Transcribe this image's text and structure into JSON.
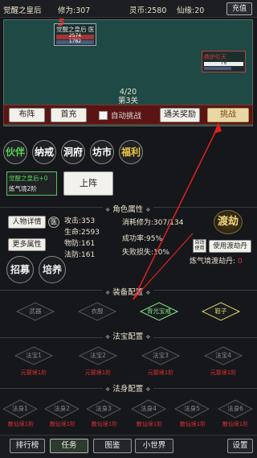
{
  "topbar": {
    "player_name": "觉醒之皇后",
    "cultivation": "修为:307",
    "spirit_stone": "灵币:2580",
    "immortal_jade": "仙缘:20",
    "recharge": "充值"
  },
  "battle": {
    "player_card": {
      "name": "觉醒之皇后 医",
      "hp": "2574",
      "mp": "1782",
      "level_mark": "5"
    },
    "enemy_card": {
      "name": "鼎炉引天",
      "hp": "76"
    },
    "progress": "4/20",
    "stage": "第3关",
    "buttons": {
      "formation": "布阵",
      "first_recharge": "首充",
      "auto_challenge": "自动挑战",
      "clear_reward": "通关奖励",
      "challenge": "挑战"
    }
  },
  "menu": [
    {
      "label": "伙伴",
      "color": "#57d05a"
    },
    {
      "label": "纳戒",
      "color": "#ffffff"
    },
    {
      "label": "洞府",
      "color": "#ffffff"
    },
    {
      "label": "坊市",
      "color": "#ffffff"
    },
    {
      "label": "福利",
      "color": "#e9c445"
    }
  ],
  "companion": {
    "name": "觉醒之皇后+0",
    "realm": "炼气境2阶",
    "deploy": "上阵"
  },
  "attributes": {
    "section_title": "角色属性",
    "person_detail": "人物详情",
    "med_tag": "医",
    "more_attr": "更多属性",
    "recruit": "招募",
    "train": "培养",
    "attack": "攻击:353",
    "hp": "生命:2593",
    "phys_def": "物防:161",
    "magic_def": "法防:161",
    "consume": "消耗修为:307/134",
    "success": "成功率:95%",
    "fail_loss": "失败损失:10%",
    "tribulation": "渡劫",
    "auto_use": "自动使用",
    "use_pill": "使用渡劫丹",
    "pill_label": "炼气境渡劫丹:",
    "pill_count": "0"
  },
  "equipment": {
    "section_title": "装备配置",
    "slots": [
      {
        "label": "武器",
        "state": "empty"
      },
      {
        "label": "衣服",
        "state": "empty"
      },
      {
        "label": "青光宝戒",
        "state": "active"
      },
      {
        "label": "鞋子",
        "state": "yellow"
      }
    ]
  },
  "treasure": {
    "section_title": "法宝配置",
    "slots": [
      {
        "label": "法宝1",
        "req": "元婴境1阶"
      },
      {
        "label": "法宝2",
        "req": "元婴境1阶"
      },
      {
        "label": "法宝3",
        "req": "元婴境1阶"
      },
      {
        "label": "法宝4",
        "req": "元婴境1阶"
      }
    ]
  },
  "avatar": {
    "section_title": "法身配置",
    "slots": [
      {
        "label": "法身1",
        "req": "散仙境1阶"
      },
      {
        "label": "法身2",
        "req": "散仙境1阶"
      },
      {
        "label": "法身3",
        "req": "散仙境1阶"
      },
      {
        "label": "法身4",
        "req": "散仙境1阶"
      },
      {
        "label": "法身5",
        "req": "散仙境1阶"
      },
      {
        "label": "法身6",
        "req": "散仙境1阶"
      }
    ]
  },
  "bottom_nav": {
    "ranking": "排行榜",
    "tasks": "任务",
    "atlas": "图鉴",
    "small_world": "小世界",
    "settings": "设置"
  }
}
